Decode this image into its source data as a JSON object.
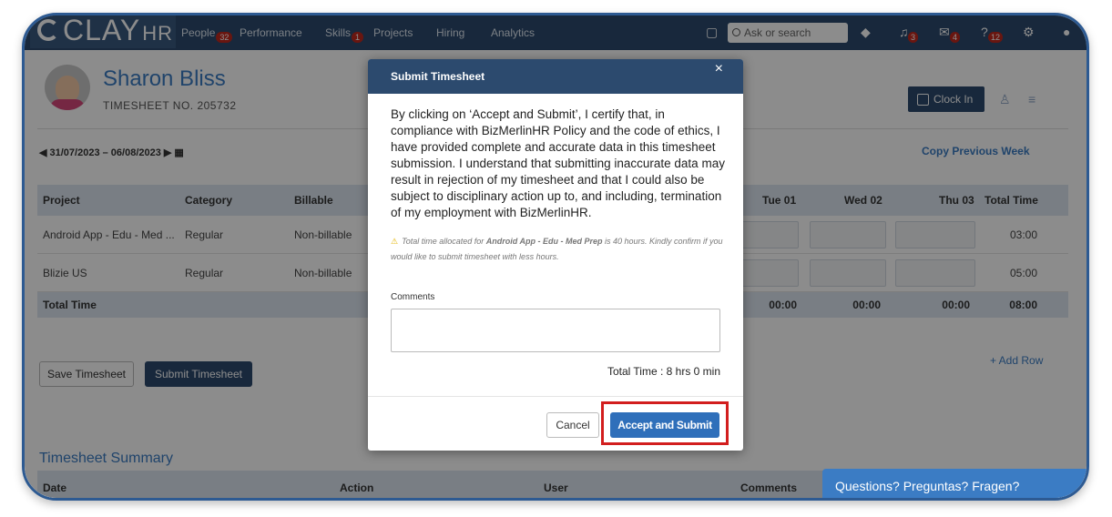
{
  "app": {
    "logo_main": "CLAY",
    "logo_suffix": "HR"
  },
  "nav": {
    "items": [
      {
        "label": "People",
        "badge": "32"
      },
      {
        "label": "Performance",
        "badge": ""
      },
      {
        "label": "Skills",
        "badge": "1"
      },
      {
        "label": "Projects",
        "badge": ""
      },
      {
        "label": "Hiring",
        "badge": ""
      },
      {
        "label": "Analytics",
        "badge": ""
      }
    ],
    "search_placeholder": "Ask or search",
    "notification_badges": {
      "bell": "3",
      "mail": "4",
      "help": "12"
    }
  },
  "employee": {
    "name": "Sharon Bliss",
    "timesheet_no": "TIMESHEET NO. 205732"
  },
  "header_actions": {
    "clock_in": "Clock In"
  },
  "timesheet": {
    "date_range": "31/07/2023 – 06/08/2023",
    "copy_previous": "Copy Previous Week",
    "columns": [
      "Project",
      "Category",
      "Billable",
      "Tue 01",
      "Wed 02",
      "Thu 03",
      "Total Time"
    ],
    "rows": [
      {
        "project": "Android App - Edu - Med ...",
        "category": "Regular",
        "billable": "Non-billable",
        "total": "03:00"
      },
      {
        "project": "Blizie US",
        "category": "Regular",
        "billable": "Non-billable",
        "total": "05:00"
      }
    ],
    "total_row": {
      "label": "Total Time",
      "tue": "00:00",
      "wed": "00:00",
      "thu": "00:00",
      "total": "08:00"
    },
    "add_row": "+ Add Row",
    "save_label": "Save Timesheet",
    "submit_label": "Submit Timesheet"
  },
  "summary": {
    "title": "Timesheet Summary",
    "columns": [
      "Date",
      "Action",
      "User",
      "Comments"
    ]
  },
  "modal": {
    "title": "Submit Timesheet",
    "close": "×",
    "body": "By clicking on ‘Accept and Submit’, I certify that, in compliance with BizMerlinHR Policy and the code of ethics, I have provided complete and accurate data in this timesheet submission. I understand that submitting inaccurate data may result in rejection of my timesheet and that I could also be subject to disciplinary action up to, and including, termination of my employment with BizMerlinHR.",
    "warning_prefix": "Total time allocated for ",
    "warning_project": "Android App - Edu - Med Prep",
    "warning_suffix": " is 40 hours. Kindly confirm if you would like to submit timesheet with less hours.",
    "comments_label": "Comments",
    "total_time": "Total Time : 8 hrs 0 min",
    "cancel": "Cancel",
    "accept": "Accept and Submit"
  },
  "help_widget": {
    "label": "Questions? Preguntas? Fragen?"
  }
}
